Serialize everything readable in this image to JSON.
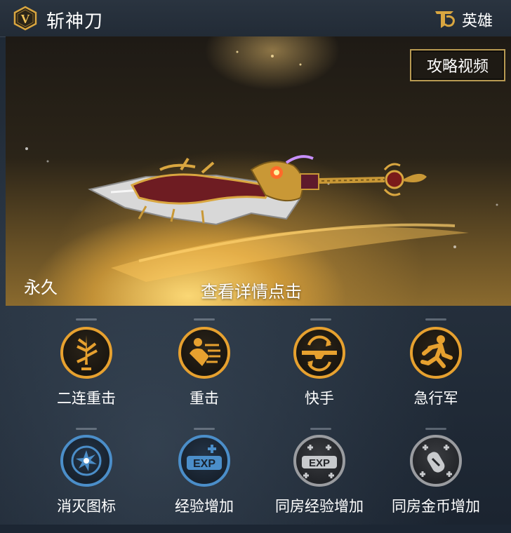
{
  "header": {
    "badge_letter": "V",
    "title": "斩神刀",
    "rank_label": "英雄"
  },
  "banner": {
    "guide_button": "攻略视频",
    "duration": "永久",
    "detail_hint": "查看详情点击"
  },
  "skills": [
    {
      "label": "二连重击",
      "icon": "double-strike-icon",
      "color": "#e7a12f"
    },
    {
      "label": "重击",
      "icon": "heavy-strike-icon",
      "color": "#e7a12f"
    },
    {
      "label": "快手",
      "icon": "quick-hand-icon",
      "color": "#e7a12f"
    },
    {
      "label": "急行军",
      "icon": "sprint-icon",
      "color": "#e7a12f"
    },
    {
      "label": "消灭图标",
      "icon": "eliminate-icon",
      "color": "#4b8ec9"
    },
    {
      "label": "经验增加",
      "icon": "exp-plus-icon",
      "color": "#4b8ec9"
    },
    {
      "label": "同房经验增加",
      "icon": "room-exp-icon",
      "color": "#9a9ca0"
    },
    {
      "label": "同房金币增加",
      "icon": "room-coin-icon",
      "color": "#9a9ca0"
    }
  ],
  "exp_text": "EXP"
}
